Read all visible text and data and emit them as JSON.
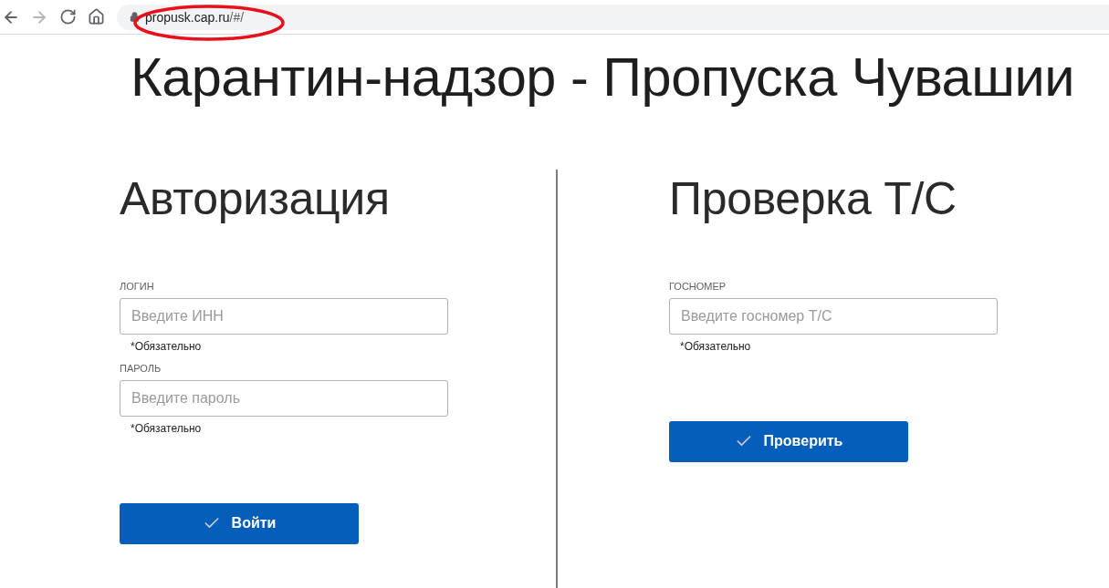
{
  "browser": {
    "nav_buttons": [
      {
        "kind": "back",
        "disabled": false
      },
      {
        "kind": "forward",
        "disabled": true
      },
      {
        "kind": "reload",
        "disabled": false
      },
      {
        "kind": "home",
        "disabled": false
      }
    ],
    "address": {
      "host": "propusk.cap.ru",
      "path": "/#/"
    },
    "annotation": {
      "kind": "ellipse"
    }
  },
  "title": "Карантин-надзор - Пропуска Чувашии",
  "panels": [
    {
      "heading": "Авторизация",
      "fields": [
        {
          "label": "ЛОГИН",
          "placeholder": "Введите ИНН",
          "note": "*Обязательно"
        },
        {
          "label": "ПАРОЛЬ",
          "placeholder": "Введите пароль",
          "note": "*Обязательно"
        }
      ],
      "button": "Войти"
    },
    {
      "heading": "Проверка Т/С",
      "fields": [
        {
          "label": "ГОСНОМЕР",
          "placeholder": "Введите госномер Т/С",
          "note": "*Обязательно"
        }
      ],
      "button": "Проверить"
    }
  ]
}
